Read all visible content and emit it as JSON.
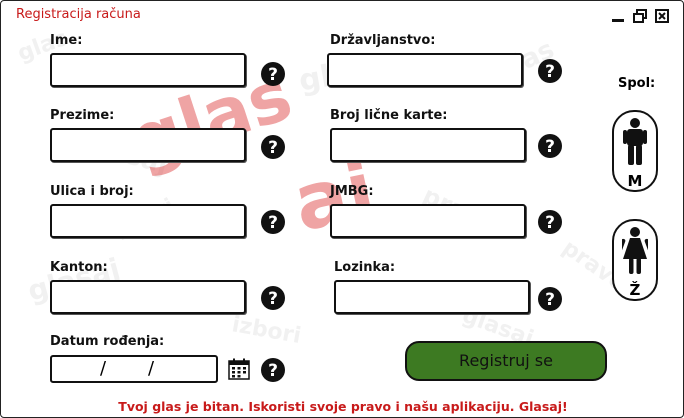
{
  "window": {
    "title": "Registracija računa"
  },
  "form": {
    "ime_label": "Ime:",
    "prezime_label": "Prezime:",
    "ulica_label": "Ulica i broj:",
    "kanton_label": "Kanton:",
    "datum_label": "Datum rođenja:",
    "drzavljanstvo_label": "Državljanstvo:",
    "broj_karte_label": "Broj lične karte:",
    "jmbg_label": "JMBG:",
    "lozinka_label": "Lozinka:",
    "date_separator": "/"
  },
  "gender": {
    "label": "Spol:",
    "male_letter": "M",
    "female_letter": "Ž"
  },
  "actions": {
    "register_label": "Registruj se"
  },
  "footer": {
    "text": "Tvoj glas je bitan. Iskoristi svoje pravo i našu aplikaciju. Glasaj!"
  },
  "icons": {
    "help": "question-circle-icon",
    "calendar": "calendar-icon",
    "male": "male-person-icon",
    "female": "female-person-icon"
  },
  "colors": {
    "accent": "#c81a1a",
    "register_button": "#3d7a22"
  }
}
